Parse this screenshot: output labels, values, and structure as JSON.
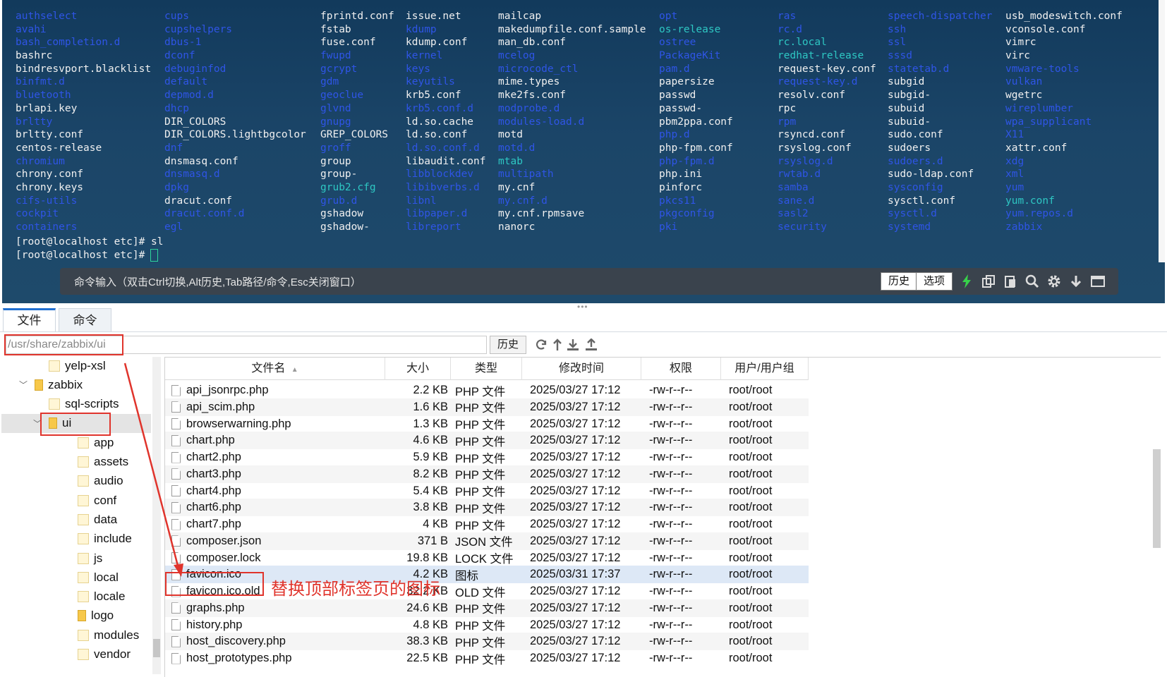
{
  "terminal": {
    "columns": [
      [
        {
          "t": "authselect",
          "c": "dir"
        },
        {
          "t": "avahi",
          "c": "dir"
        },
        {
          "t": "bash_completion.d",
          "c": "dir"
        },
        {
          "t": "bashrc",
          "c": "file"
        },
        {
          "t": "bindresvport.blacklist",
          "c": "file"
        },
        {
          "t": "binfmt.d",
          "c": "dir"
        },
        {
          "t": "bluetooth",
          "c": "dir"
        },
        {
          "t": "brlapi.key",
          "c": "file"
        },
        {
          "t": "brltty",
          "c": "dir"
        },
        {
          "t": "brltty.conf",
          "c": "file"
        },
        {
          "t": "centos-release",
          "c": "file"
        },
        {
          "t": "chromium",
          "c": "dir"
        },
        {
          "t": "chrony.conf",
          "c": "file"
        },
        {
          "t": "chrony.keys",
          "c": "file"
        },
        {
          "t": "cifs-utils",
          "c": "dir"
        },
        {
          "t": "cockpit",
          "c": "dir"
        },
        {
          "t": "containers",
          "c": "dir"
        }
      ],
      [
        {
          "t": "cups",
          "c": "dir"
        },
        {
          "t": "cupshelpers",
          "c": "dir"
        },
        {
          "t": "dbus-1",
          "c": "dir"
        },
        {
          "t": "dconf",
          "c": "dir"
        },
        {
          "t": "debuginfod",
          "c": "dir"
        },
        {
          "t": "default",
          "c": "dir"
        },
        {
          "t": "depmod.d",
          "c": "dir"
        },
        {
          "t": "dhcp",
          "c": "dir"
        },
        {
          "t": "DIR_COLORS",
          "c": "file"
        },
        {
          "t": "DIR_COLORS.lightbgcolor",
          "c": "file"
        },
        {
          "t": "dnf",
          "c": "dir"
        },
        {
          "t": "dnsmasq.conf",
          "c": "file"
        },
        {
          "t": "dnsmasq.d",
          "c": "dir"
        },
        {
          "t": "dpkg",
          "c": "dir"
        },
        {
          "t": "dracut.conf",
          "c": "file"
        },
        {
          "t": "dracut.conf.d",
          "c": "dir"
        },
        {
          "t": "egl",
          "c": "dir"
        }
      ],
      [
        {
          "t": "fprintd.conf",
          "c": "file"
        },
        {
          "t": "fstab",
          "c": "file"
        },
        {
          "t": "fuse.conf",
          "c": "file"
        },
        {
          "t": "fwupd",
          "c": "dir"
        },
        {
          "t": "gcrypt",
          "c": "dir"
        },
        {
          "t": "gdm",
          "c": "dir"
        },
        {
          "t": "geoclue",
          "c": "dir"
        },
        {
          "t": "glvnd",
          "c": "dir"
        },
        {
          "t": "gnupg",
          "c": "dir"
        },
        {
          "t": "GREP_COLORS",
          "c": "file"
        },
        {
          "t": "groff",
          "c": "dir"
        },
        {
          "t": "group",
          "c": "file"
        },
        {
          "t": "group-",
          "c": "file"
        },
        {
          "t": "grub2.cfg",
          "c": "teal"
        },
        {
          "t": "grub.d",
          "c": "dir"
        },
        {
          "t": "gshadow",
          "c": "file"
        },
        {
          "t": "gshadow-",
          "c": "file"
        }
      ],
      [
        {
          "t": "issue.net",
          "c": "file"
        },
        {
          "t": "kdump",
          "c": "dir"
        },
        {
          "t": "kdump.conf",
          "c": "file"
        },
        {
          "t": "kernel",
          "c": "dir"
        },
        {
          "t": "keys",
          "c": "dir"
        },
        {
          "t": "keyutils",
          "c": "dir"
        },
        {
          "t": "krb5.conf",
          "c": "file"
        },
        {
          "t": "krb5.conf.d",
          "c": "dir"
        },
        {
          "t": "ld.so.cache",
          "c": "file"
        },
        {
          "t": "ld.so.conf",
          "c": "file"
        },
        {
          "t": "ld.so.conf.d",
          "c": "dir"
        },
        {
          "t": "libaudit.conf",
          "c": "file"
        },
        {
          "t": "libblockdev",
          "c": "dir"
        },
        {
          "t": "libibverbs.d",
          "c": "dir"
        },
        {
          "t": "libnl",
          "c": "dir"
        },
        {
          "t": "libpaper.d",
          "c": "dir"
        },
        {
          "t": "libreport",
          "c": "dir"
        }
      ],
      [
        {
          "t": "mailcap",
          "c": "file"
        },
        {
          "t": "makedumpfile.conf.sample",
          "c": "file"
        },
        {
          "t": "man_db.conf",
          "c": "file"
        },
        {
          "t": "mcelog",
          "c": "dir"
        },
        {
          "t": "microcode_ctl",
          "c": "dir"
        },
        {
          "t": "mime.types",
          "c": "file"
        },
        {
          "t": "mke2fs.conf",
          "c": "file"
        },
        {
          "t": "modprobe.d",
          "c": "dir"
        },
        {
          "t": "modules-load.d",
          "c": "dir"
        },
        {
          "t": "motd",
          "c": "file"
        },
        {
          "t": "motd.d",
          "c": "dir"
        },
        {
          "t": "mtab",
          "c": "teal"
        },
        {
          "t": "multipath",
          "c": "dir"
        },
        {
          "t": "my.cnf",
          "c": "file"
        },
        {
          "t": "my.cnf.d",
          "c": "dir"
        },
        {
          "t": "my.cnf.rpmsave",
          "c": "file"
        },
        {
          "t": "nanorc",
          "c": "file"
        }
      ],
      [
        {
          "t": "opt",
          "c": "dir"
        },
        {
          "t": "os-release",
          "c": "teal"
        },
        {
          "t": "ostree",
          "c": "dir"
        },
        {
          "t": "PackageKit",
          "c": "dir"
        },
        {
          "t": "pam.d",
          "c": "dir"
        },
        {
          "t": "papersize",
          "c": "file"
        },
        {
          "t": "passwd",
          "c": "file"
        },
        {
          "t": "passwd-",
          "c": "file"
        },
        {
          "t": "pbm2ppa.conf",
          "c": "file"
        },
        {
          "t": "php.d",
          "c": "dir"
        },
        {
          "t": "php-fpm.conf",
          "c": "file"
        },
        {
          "t": "php-fpm.d",
          "c": "dir"
        },
        {
          "t": "php.ini",
          "c": "file"
        },
        {
          "t": "pinforc",
          "c": "file"
        },
        {
          "t": "pkcs11",
          "c": "dir"
        },
        {
          "t": "pkgconfig",
          "c": "dir"
        },
        {
          "t": "pki",
          "c": "dir"
        }
      ],
      [
        {
          "t": "ras",
          "c": "dir"
        },
        {
          "t": "rc.d",
          "c": "dir"
        },
        {
          "t": "rc.local",
          "c": "teal"
        },
        {
          "t": "redhat-release",
          "c": "teal"
        },
        {
          "t": "request-key.conf",
          "c": "file"
        },
        {
          "t": "request-key.d",
          "c": "dir"
        },
        {
          "t": "resolv.conf",
          "c": "file"
        },
        {
          "t": "rpc",
          "c": "file"
        },
        {
          "t": "rpm",
          "c": "dir"
        },
        {
          "t": "rsyncd.conf",
          "c": "file"
        },
        {
          "t": "rsyslog.conf",
          "c": "file"
        },
        {
          "t": "rsyslog.d",
          "c": "dir"
        },
        {
          "t": "rwtab.d",
          "c": "dir"
        },
        {
          "t": "samba",
          "c": "dir"
        },
        {
          "t": "sane.d",
          "c": "dir"
        },
        {
          "t": "sasl2",
          "c": "dir"
        },
        {
          "t": "security",
          "c": "dir"
        }
      ],
      [
        {
          "t": "speech-dispatcher",
          "c": "dir"
        },
        {
          "t": "ssh",
          "c": "dir"
        },
        {
          "t": "ssl",
          "c": "dir"
        },
        {
          "t": "sssd",
          "c": "dir"
        },
        {
          "t": "statetab.d",
          "c": "dir"
        },
        {
          "t": "subgid",
          "c": "file"
        },
        {
          "t": "subgid-",
          "c": "file"
        },
        {
          "t": "subuid",
          "c": "file"
        },
        {
          "t": "subuid-",
          "c": "file"
        },
        {
          "t": "sudo.conf",
          "c": "file"
        },
        {
          "t": "sudoers",
          "c": "file"
        },
        {
          "t": "sudoers.d",
          "c": "dir"
        },
        {
          "t": "sudo-ldap.conf",
          "c": "file"
        },
        {
          "t": "sysconfig",
          "c": "dir"
        },
        {
          "t": "sysctl.conf",
          "c": "file"
        },
        {
          "t": "sysctl.d",
          "c": "dir"
        },
        {
          "t": "systemd",
          "c": "dir"
        }
      ],
      [
        {
          "t": "usb_modeswitch.conf",
          "c": "file"
        },
        {
          "t": "vconsole.conf",
          "c": "file"
        },
        {
          "t": "vimrc",
          "c": "file"
        },
        {
          "t": "virc",
          "c": "file"
        },
        {
          "t": "vmware-tools",
          "c": "dir"
        },
        {
          "t": "vulkan",
          "c": "dir"
        },
        {
          "t": "wgetrc",
          "c": "file"
        },
        {
          "t": "wireplumber",
          "c": "dir"
        },
        {
          "t": "wpa_supplicant",
          "c": "dir"
        },
        {
          "t": "X11",
          "c": "dir"
        },
        {
          "t": "xattr.conf",
          "c": "file"
        },
        {
          "t": "xdg",
          "c": "dir"
        },
        {
          "t": "xml",
          "c": "dir"
        },
        {
          "t": "yum",
          "c": "dir"
        },
        {
          "t": "yum.conf",
          "c": "teal"
        },
        {
          "t": "yum.repos.d",
          "c": "dir"
        },
        {
          "t": "zabbix",
          "c": "dir"
        }
      ]
    ],
    "prompt_line_1": "[root@localhost etc]# sl",
    "prompt_line_2": "[root@localhost etc]#",
    "colors": {
      "dir": "#2f55e6",
      "teal": "#2ec7c3",
      "file": "#f0f0f0",
      "cursor": "#2fd39b"
    }
  },
  "command_bar": {
    "hint": "命令输入（双击Ctrl切换,Alt历史,Tab路径/命令,Esc关闭窗口）",
    "history_button": "历史",
    "options_button": "选项",
    "icons": [
      "lightning-icon",
      "copy-icon",
      "paste-icon",
      "search-icon",
      "gear-icon",
      "download-icon",
      "window-icon"
    ]
  },
  "tabs": [
    {
      "label": "文件",
      "active": true
    },
    {
      "label": "命令",
      "active": false
    }
  ],
  "pathbar": {
    "path": "/usr/share/zabbix/ui",
    "history_button": "历史",
    "icons": [
      "refresh-icon",
      "up-arrow-icon",
      "download-icon",
      "upload-icon"
    ]
  },
  "tree": [
    {
      "label": "yelp-xsl",
      "depth": 3,
      "expanded": false,
      "selected": false,
      "has_chevron": false
    },
    {
      "label": "zabbix",
      "depth": 2,
      "expanded": true,
      "selected": false,
      "has_chevron": true
    },
    {
      "label": "sql-scripts",
      "depth": 3,
      "expanded": false,
      "selected": false,
      "has_chevron": false
    },
    {
      "label": "ui",
      "depth": 3,
      "expanded": true,
      "selected": true,
      "has_chevron": true
    },
    {
      "label": "app",
      "depth": 4,
      "expanded": false,
      "selected": false,
      "has_chevron": false
    },
    {
      "label": "assets",
      "depth": 4,
      "expanded": false,
      "selected": false,
      "has_chevron": false
    },
    {
      "label": "audio",
      "depth": 4,
      "expanded": false,
      "selected": false,
      "has_chevron": false
    },
    {
      "label": "conf",
      "depth": 4,
      "expanded": false,
      "selected": false,
      "has_chevron": false
    },
    {
      "label": "data",
      "depth": 4,
      "expanded": false,
      "selected": false,
      "has_chevron": false
    },
    {
      "label": "include",
      "depth": 4,
      "expanded": false,
      "selected": false,
      "has_chevron": false
    },
    {
      "label": "js",
      "depth": 4,
      "expanded": false,
      "selected": false,
      "has_chevron": false
    },
    {
      "label": "local",
      "depth": 4,
      "expanded": false,
      "selected": false,
      "has_chevron": false
    },
    {
      "label": "locale",
      "depth": 4,
      "expanded": false,
      "selected": false,
      "has_chevron": false
    },
    {
      "label": "logo",
      "depth": 4,
      "expanded": false,
      "selected": false,
      "has_chevron": false,
      "open_folder": true
    },
    {
      "label": "modules",
      "depth": 4,
      "expanded": false,
      "selected": false,
      "has_chevron": false
    },
    {
      "label": "vendor",
      "depth": 4,
      "expanded": false,
      "selected": false,
      "has_chevron": false
    }
  ],
  "file_table": {
    "headers": {
      "name": "文件名",
      "size": "大小",
      "type": "类型",
      "mtime": "修改时间",
      "perm": "权限",
      "owner": "用户/用户组"
    },
    "sort_indicator": "▲",
    "rows": [
      {
        "name": "api_jsonrpc.php",
        "size": "2.2 KB",
        "type": "PHP 文件",
        "mtime": "2025/03/27 17:12",
        "perm": "-rw-r--r--",
        "owner": "root/root"
      },
      {
        "name": "api_scim.php",
        "size": "1.6 KB",
        "type": "PHP 文件",
        "mtime": "2025/03/27 17:12",
        "perm": "-rw-r--r--",
        "owner": "root/root"
      },
      {
        "name": "browserwarning.php",
        "size": "1.3 KB",
        "type": "PHP 文件",
        "mtime": "2025/03/27 17:12",
        "perm": "-rw-r--r--",
        "owner": "root/root"
      },
      {
        "name": "chart.php",
        "size": "4.6 KB",
        "type": "PHP 文件",
        "mtime": "2025/03/27 17:12",
        "perm": "-rw-r--r--",
        "owner": "root/root"
      },
      {
        "name": "chart2.php",
        "size": "5.9 KB",
        "type": "PHP 文件",
        "mtime": "2025/03/27 17:12",
        "perm": "-rw-r--r--",
        "owner": "root/root"
      },
      {
        "name": "chart3.php",
        "size": "8.2 KB",
        "type": "PHP 文件",
        "mtime": "2025/03/27 17:12",
        "perm": "-rw-r--r--",
        "owner": "root/root"
      },
      {
        "name": "chart4.php",
        "size": "5.4 KB",
        "type": "PHP 文件",
        "mtime": "2025/03/27 17:12",
        "perm": "-rw-r--r--",
        "owner": "root/root"
      },
      {
        "name": "chart6.php",
        "size": "3.8 KB",
        "type": "PHP 文件",
        "mtime": "2025/03/27 17:12",
        "perm": "-rw-r--r--",
        "owner": "root/root"
      },
      {
        "name": "chart7.php",
        "size": "4 KB",
        "type": "PHP 文件",
        "mtime": "2025/03/27 17:12",
        "perm": "-rw-r--r--",
        "owner": "root/root"
      },
      {
        "name": "composer.json",
        "size": "371 B",
        "type": "JSON 文件",
        "mtime": "2025/03/27 17:12",
        "perm": "-rw-r--r--",
        "owner": "root/root"
      },
      {
        "name": "composer.lock",
        "size": "19.8 KB",
        "type": "LOCK 文件",
        "mtime": "2025/03/27 17:12",
        "perm": "-rw-r--r--",
        "owner": "root/root"
      },
      {
        "name": "favicon.ico",
        "size": "4.2 KB",
        "type": "图标",
        "mtime": "2025/03/31 17:37",
        "perm": "-rw-r--r--",
        "owner": "root/root",
        "selected": true
      },
      {
        "name": "favicon.ico.old",
        "size": "32.2 KB",
        "type": "OLD 文件",
        "mtime": "2025/03/27 17:12",
        "perm": "-rw-r--r--",
        "owner": "root/root"
      },
      {
        "name": "graphs.php",
        "size": "24.6 KB",
        "type": "PHP 文件",
        "mtime": "2025/03/27 17:12",
        "perm": "-rw-r--r--",
        "owner": "root/root"
      },
      {
        "name": "history.php",
        "size": "4.8 KB",
        "type": "PHP 文件",
        "mtime": "2025/03/27 17:12",
        "perm": "-rw-r--r--",
        "owner": "root/root"
      },
      {
        "name": "host_discovery.php",
        "size": "38.3 KB",
        "type": "PHP 文件",
        "mtime": "2025/03/27 17:12",
        "perm": "-rw-r--r--",
        "owner": "root/root"
      },
      {
        "name": "host_prototypes.php",
        "size": "22.5 KB",
        "type": "PHP 文件",
        "mtime": "2025/03/27 17:12",
        "perm": "-rw-r--r--",
        "owner": "root/root"
      }
    ]
  },
  "annotation": {
    "text": "替换顶部标签页的图标",
    "color": "#e0342c"
  }
}
